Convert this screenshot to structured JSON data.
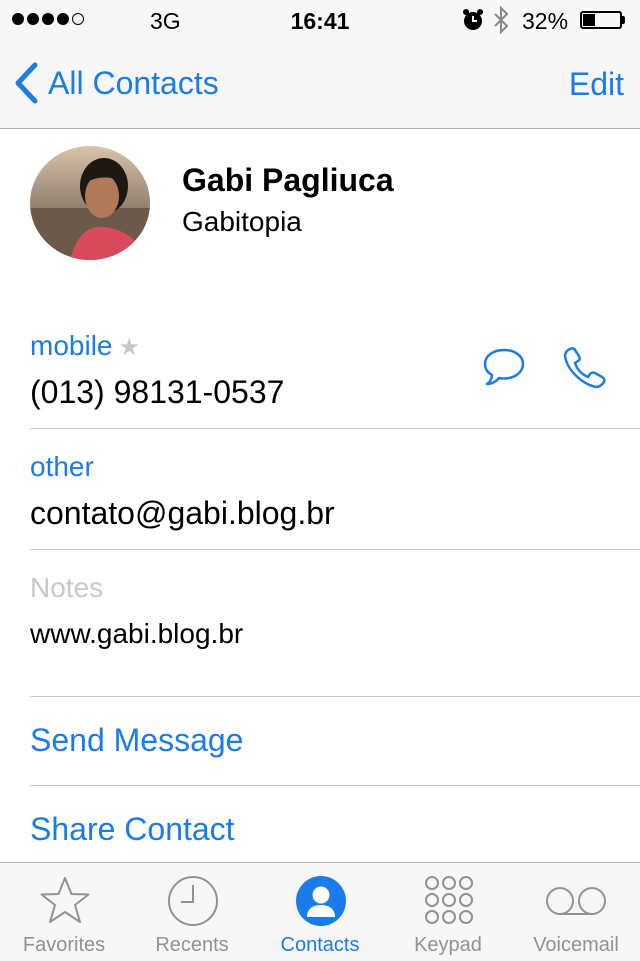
{
  "status_bar": {
    "carrier": "3G",
    "time": "16:41",
    "battery_percent": "32%",
    "battery_level": 0.32,
    "signal_bars_filled": 4,
    "signal_bars_total": 5
  },
  "nav": {
    "back_label": "All Contacts",
    "edit_label": "Edit"
  },
  "contact": {
    "name": "Gabi Pagliuca",
    "company": "Gabitopia"
  },
  "fields": {
    "phone_label": "mobile",
    "phone_star": "★",
    "phone_value": "(013) 98131-0537",
    "email_label": "other",
    "email_value": "contato@gabi.blog.br",
    "notes_label": "Notes",
    "notes_value": "www.gabi.blog.br"
  },
  "actions": {
    "send_message": "Send Message",
    "share_contact": "Share Contact"
  },
  "tabbar": {
    "tabs": [
      {
        "label": "Favorites",
        "icon": "star-icon"
      },
      {
        "label": "Recents",
        "icon": "clock-icon"
      },
      {
        "label": "Contacts",
        "icon": "person-icon"
      },
      {
        "label": "Keypad",
        "icon": "keypad-icon"
      },
      {
        "label": "Voicemail",
        "icon": "voicemail-icon"
      }
    ],
    "active_tab": "Contacts"
  },
  "colors": {
    "accent": "#1a7ce8",
    "inactive": "#929292",
    "separator": "#c8c7cc",
    "bar_background": "#f7f7f7"
  }
}
